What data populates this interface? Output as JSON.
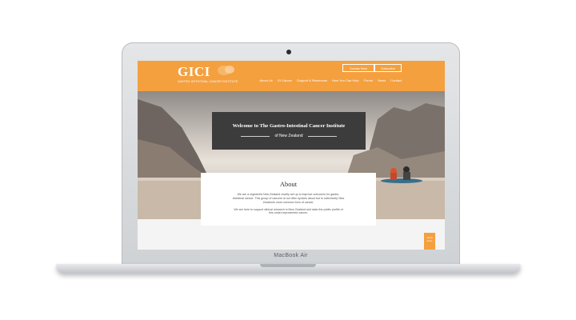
{
  "site": {
    "logo": "GICI",
    "logo_subtitle": "GASTRO-INTESTINAL CANCER INSTITUTE",
    "donate_label": "Donate Now",
    "subscribe_label": "Subscribe",
    "nav": [
      "About Us",
      "GI Cancer",
      "Support & Resources",
      "How You Can Help",
      "Forum",
      "News",
      "Contact"
    ],
    "hero_title": "Welcome to The Gastro-Intestinal Cancer Institute",
    "hero_subtitle": "of New Zealand",
    "about_heading": "About",
    "about_p1": "We are a registered New Zealand charity set up to improve outcomes for gastro-intestinal cancer. This group of cancers is not often spoken about but is collectively New Zealand's most common form of cancer.",
    "about_p2": "We are here to support clinical research in New Zealand and raise the public profile of this under-represented cancer.",
    "scroll_label": "Scroll down"
  },
  "device_label": "MacBook Air",
  "colors": {
    "accent": "#f4a03f",
    "banner": "#3c3c3c"
  }
}
